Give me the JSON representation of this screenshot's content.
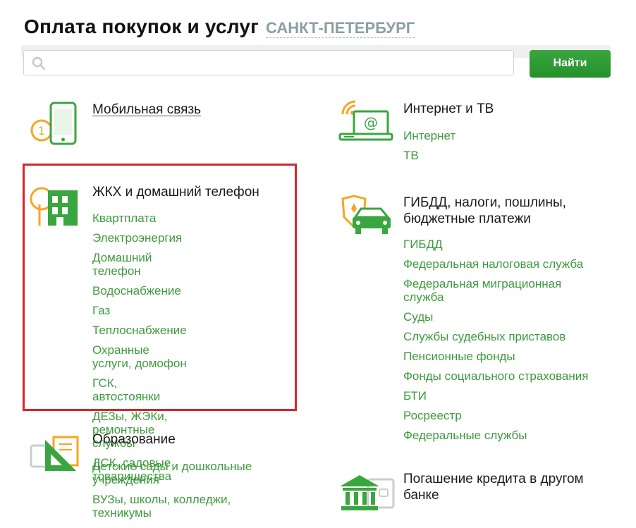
{
  "header": {
    "title": "Оплата покупок и услуг",
    "city": "САНКТ-ПЕТЕРБУРГ"
  },
  "search": {
    "placeholder": "",
    "button_label": "Найти"
  },
  "categories": {
    "mobile": {
      "title": "Мобильная связь",
      "icon": "mobile-phone-icon",
      "items": []
    },
    "internet": {
      "title": "Интернет и ТВ",
      "icon": "laptop-wifi-icon",
      "items": [
        "Интернет",
        "ТВ"
      ]
    },
    "housing": {
      "title": "ЖКХ и домашний телефон",
      "icon": "house-icon",
      "items": [
        "Квартплата",
        "Электроэнергия",
        "Домашний телефон",
        "Водоснабжение",
        "Газ",
        "Теплоснабжение",
        "Охранные услуги, домофон",
        "ГСК, автостоянки",
        "ДЕЗы, ЖЭКи, ремонтные службы",
        "ДСК, садовые товарищества"
      ]
    },
    "gibdd": {
      "title_line1": "ГИБДД, налоги, пошлины,",
      "title_line2": "бюджетные платежи",
      "icon": "car-emblem-icon",
      "items": [
        "ГИБДД",
        "Федеральная налоговая служба",
        "Федеральная миграционная служба",
        "Суды",
        "Службы судебных приставов",
        "Пенсионные фонды",
        "Фонды социального страхования",
        "БТИ",
        "Росреестр",
        "Федеральные службы"
      ]
    },
    "education": {
      "title": "Образование",
      "icon": "ruler-triangle-icon",
      "items": [
        "Детские сады и дошкольные учреждения",
        "ВУЗы, школы, колледжи, техникумы"
      ]
    },
    "credit": {
      "title_line1": "Погашение кредита в другом",
      "title_line2": "банке",
      "icon": "bank-building-icon",
      "items": []
    }
  },
  "colors": {
    "accent_green": "#3d9a3d",
    "button_green": "#24912a",
    "highlight_red": "#d6252c",
    "icon_orange": "#f5a623"
  }
}
